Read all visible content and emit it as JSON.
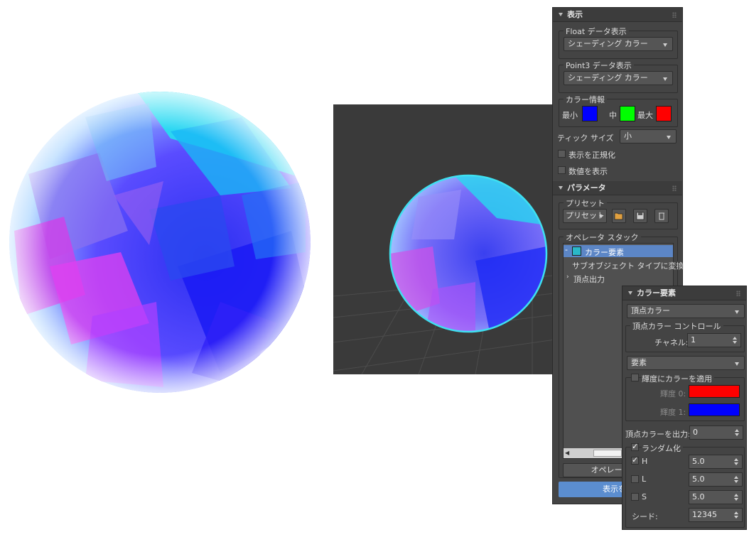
{
  "display_rollout": {
    "title": "表示",
    "float_group_title": "Float データ表示",
    "float_dropdown": "シェーディング カラー",
    "point3_group_title": "Point3 データ表示",
    "point3_dropdown": "シェーディング カラー",
    "color_info_title": "カラー情報",
    "min_label": "最小",
    "mid_label": "中",
    "max_label": "最大",
    "min_color": "#0000ff",
    "mid_color": "#00ff00",
    "max_color": "#ff0000",
    "tick_size_label": "ティック サイズ",
    "tick_size_value": "小",
    "normalize_label": "表示を正規化",
    "show_values_label": "数値を表示"
  },
  "params_rollout": {
    "title": "パラメータ",
    "preset_group_title": "プリセット",
    "preset_button": "プリセット",
    "operator_stack_title": "オペレータ スタック",
    "stack_items": [
      "カラー要素",
      "サブオブジェクト タイプに変換",
      "頂点出力"
    ],
    "add_operator_button": "オペレータを追",
    "display_button": "表示を有"
  },
  "color_elements_rollout": {
    "title": "カラー要素",
    "type_dropdown": "頂点カラー",
    "vc_group_title": "頂点カラー コントロール",
    "channel_label": "チャネル:",
    "channel_value": "1",
    "element_dropdown": "要素",
    "apply_luminance_label": "輝度にカラーを適用",
    "lum0_label": "輝度 0:",
    "lum1_label": "輝度 1:",
    "lum0_color": "#ff0000",
    "lum1_color": "#0000ff",
    "output_label": "頂点カラーを出力:",
    "output_value": "0",
    "randomize_label": "ランダム化",
    "h_label": "H",
    "h_value": "5.0",
    "l_label": "L",
    "l_value": "5.0",
    "s_label": "S",
    "s_value": "5.0",
    "seed_label": "シード:",
    "seed_value": "12345"
  }
}
